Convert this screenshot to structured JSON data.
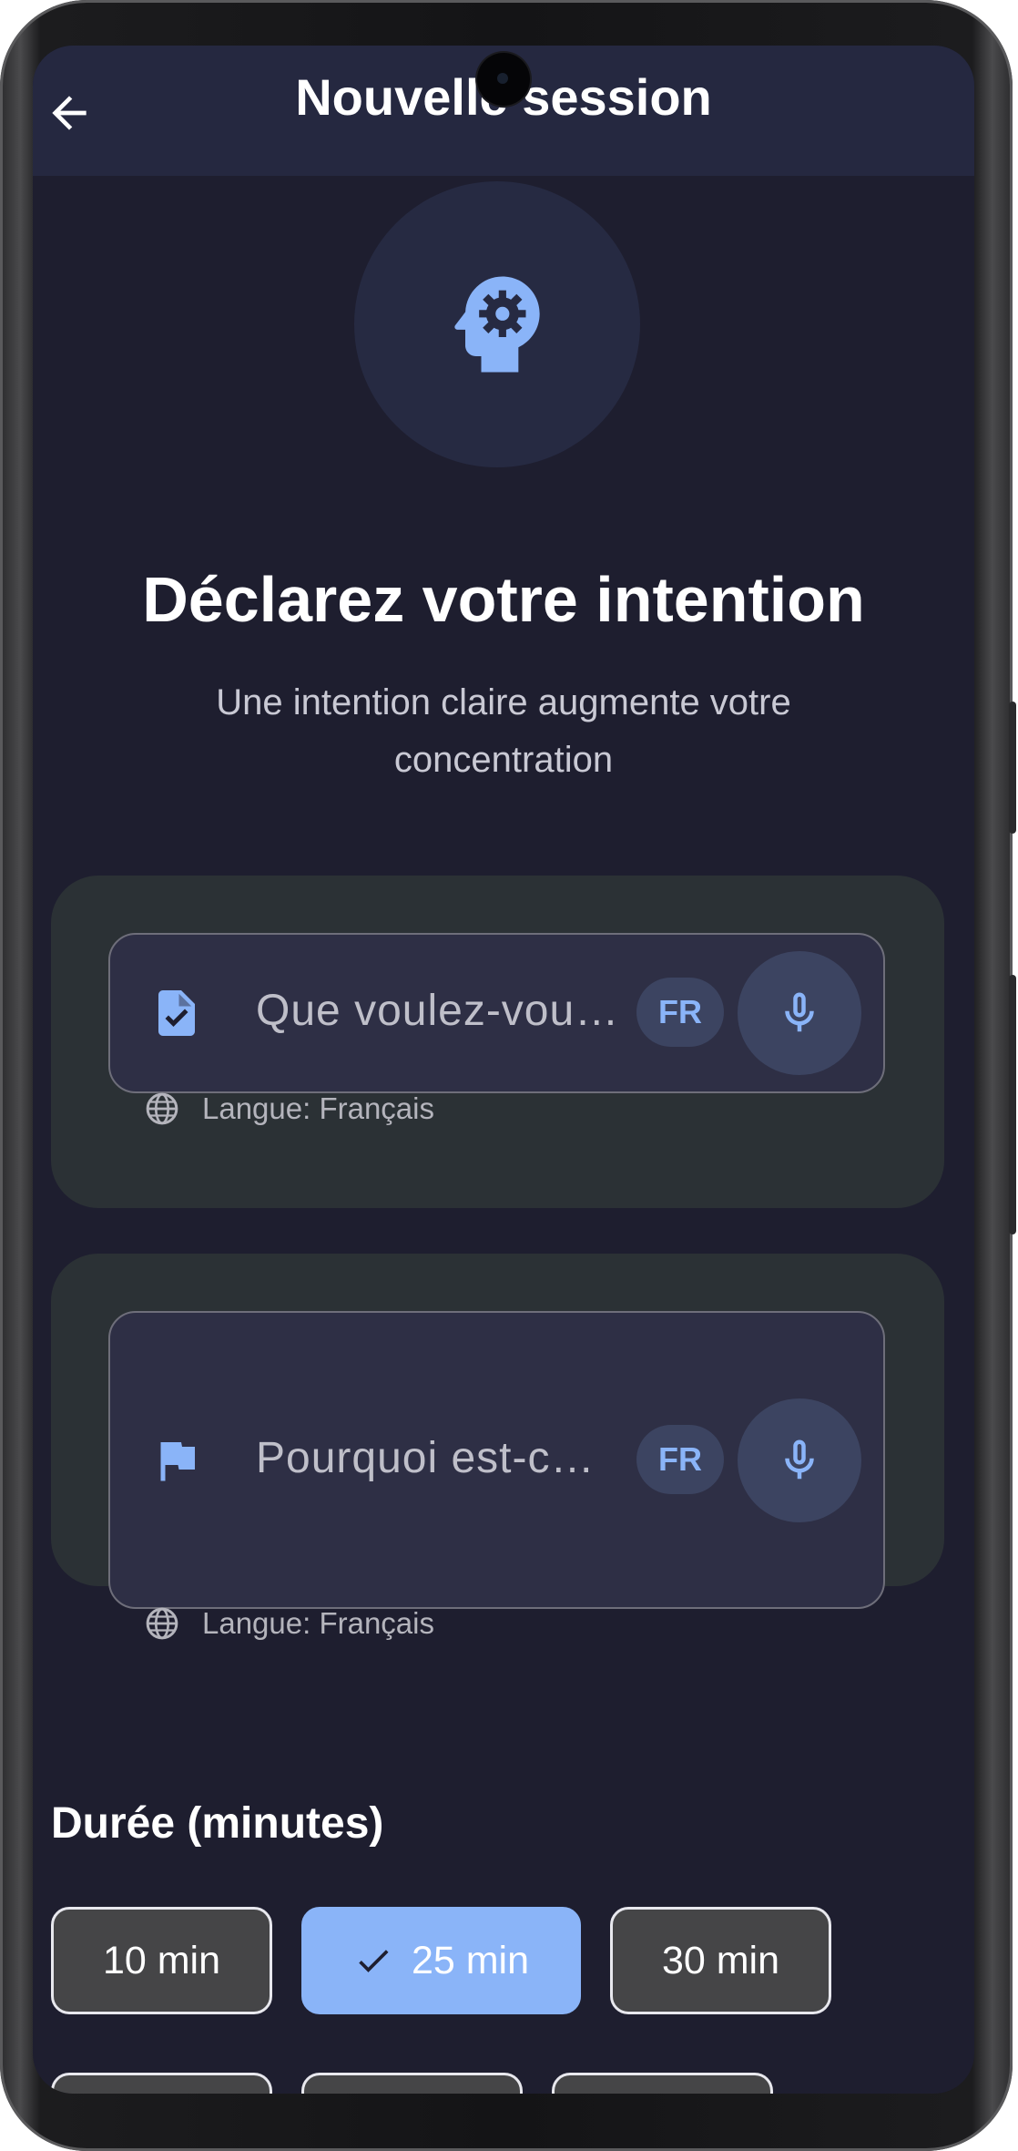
{
  "header": {
    "title": "Nouvelle session",
    "back_icon": "arrow-back-icon"
  },
  "hero": {
    "icon": "psychology-head-gear-icon",
    "heading": "Déclarez votre intention",
    "subtitle": "Une intention claire augmente votre concentration"
  },
  "intention_field": {
    "icon": "task-document-check-icon",
    "placeholder": "Que voulez-vou…",
    "lang_chip": "FR",
    "mic_icon": "microphone-icon",
    "language_label": "Langue: Français"
  },
  "reason_field": {
    "icon": "flag-icon",
    "placeholder": "Pourquoi est-c…",
    "lang_chip": "FR",
    "mic_icon": "microphone-icon",
    "language_label": "Langue: Français"
  },
  "duration": {
    "title": "Durée (minutes)",
    "options": [
      {
        "label": "10 min",
        "selected": false
      },
      {
        "label": "25 min",
        "selected": true
      },
      {
        "label": "30 min",
        "selected": false
      }
    ]
  },
  "colors": {
    "background": "#1e1e2f",
    "app_bar": "#252840",
    "card": "#2b3135",
    "accent": "#8ab4f8",
    "chip_unselected": "#454547"
  }
}
